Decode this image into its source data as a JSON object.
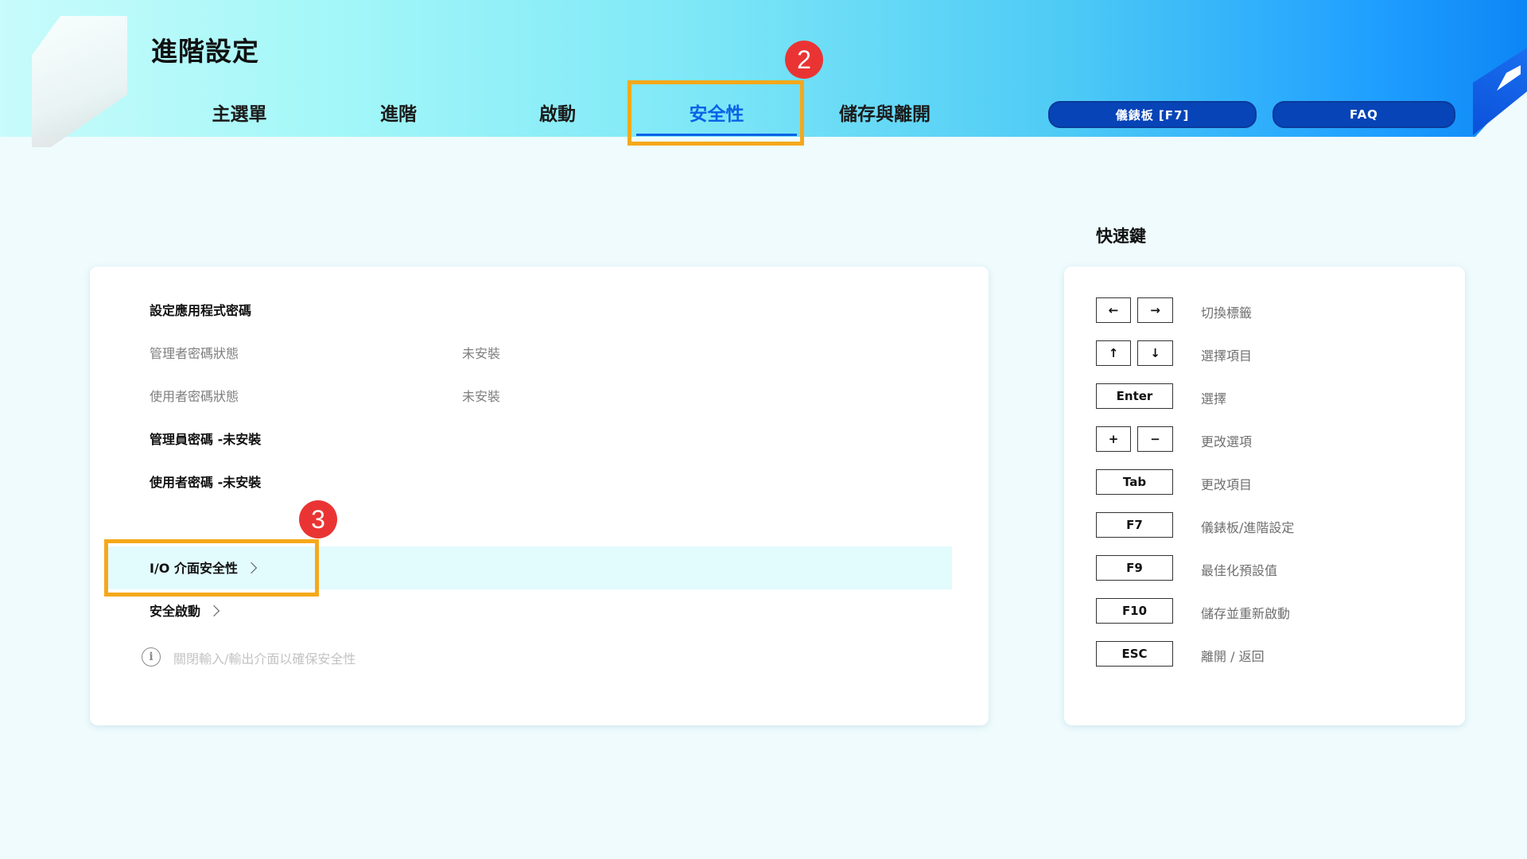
{
  "header": {
    "title": "進階設定",
    "tabs": [
      {
        "label": "主選單"
      },
      {
        "label": "進階"
      },
      {
        "label": "啟動"
      },
      {
        "label": "安全性"
      },
      {
        "label": "儲存與離開"
      }
    ],
    "active_tab": "安全性",
    "dashboard_button": "儀錶板 [F7]",
    "faq_button": "FAQ"
  },
  "annotations": {
    "step2": "2",
    "step3": "3",
    "box_color": "#f5a81b",
    "badge_color": "#ea3434"
  },
  "security": {
    "section_title": "設定應用程式密碼",
    "admin_status_label": "管理者密碼狀態",
    "admin_status_value": "未安裝",
    "user_status_label": "使用者密碼狀態",
    "user_status_value": "未安裝",
    "admin_password_item": "管理員密碼 -未安裝",
    "user_password_item": "使用者密碼 -未安裝",
    "io_security_item": "I/O 介面安全性",
    "secure_boot_item": "安全啟動",
    "hint": "關閉輸入/輸出介面以確保安全性"
  },
  "hotkeys": {
    "title": "快速鍵",
    "items": [
      {
        "keys": [
          "←",
          "→"
        ],
        "desc": "切換標籤"
      },
      {
        "keys": [
          "↑",
          "↓"
        ],
        "desc": "選擇項目"
      },
      {
        "keys": [
          "Enter"
        ],
        "desc": "選擇"
      },
      {
        "keys": [
          "+",
          "−"
        ],
        "desc": "更改選項"
      },
      {
        "keys": [
          "Tab"
        ],
        "desc": "更改項目"
      },
      {
        "keys": [
          "F7"
        ],
        "desc": "儀錶板/進階設定"
      },
      {
        "keys": [
          "F9"
        ],
        "desc": "最佳化預設值"
      },
      {
        "keys": [
          "F10"
        ],
        "desc": "儲存並重新啟動"
      },
      {
        "keys": [
          "ESC"
        ],
        "desc": "離開 / 返回"
      }
    ]
  },
  "colors": {
    "accent": "#0a62e6",
    "pill_bg": "#0744b7",
    "highlight_row": "#e2fbfd"
  }
}
